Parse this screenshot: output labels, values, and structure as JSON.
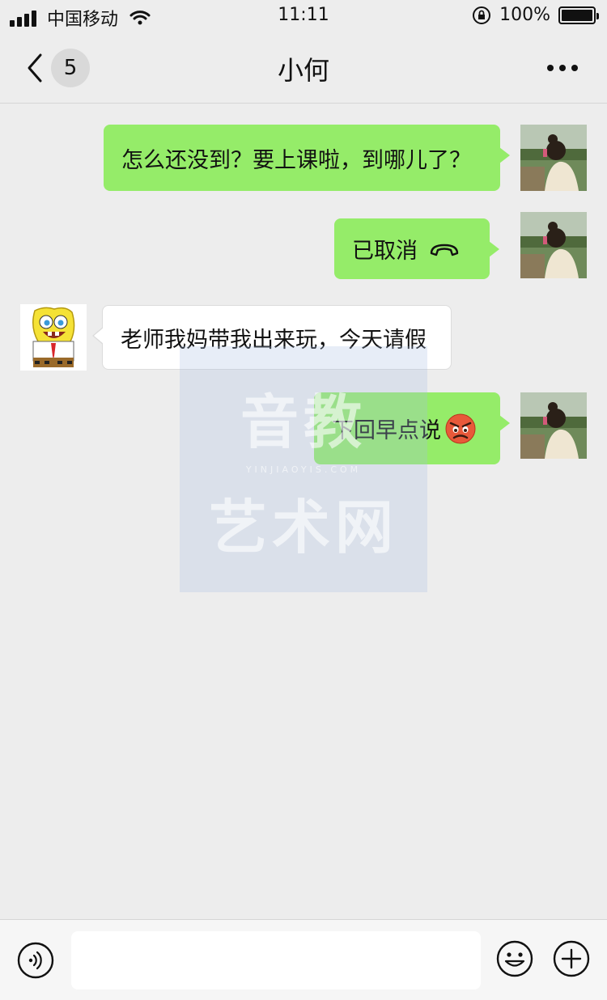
{
  "status_bar": {
    "carrier": "中国移动",
    "time": "11:11",
    "battery": "100%"
  },
  "nav": {
    "unread_count": "5",
    "title": "小何"
  },
  "messages": [
    {
      "direction": "out",
      "text": "怎么还没到？要上课啦，到哪儿了？"
    },
    {
      "direction": "out",
      "text": "已取消",
      "icon": "hang-up-icon"
    },
    {
      "direction": "in",
      "text": "老师我妈带我出来玩，今天请假"
    },
    {
      "direction": "out",
      "text": "下回早点说",
      "icon": "angry-face-emoji"
    }
  ],
  "watermark": {
    "line1": "音教",
    "url": "YINJIAOYIS.COM",
    "line2": "艺术网"
  },
  "input_bar": {
    "value": ""
  },
  "colors": {
    "background": "#ededed",
    "outgoing_bubble": "#95ec69",
    "incoming_bubble": "#ffffff"
  }
}
